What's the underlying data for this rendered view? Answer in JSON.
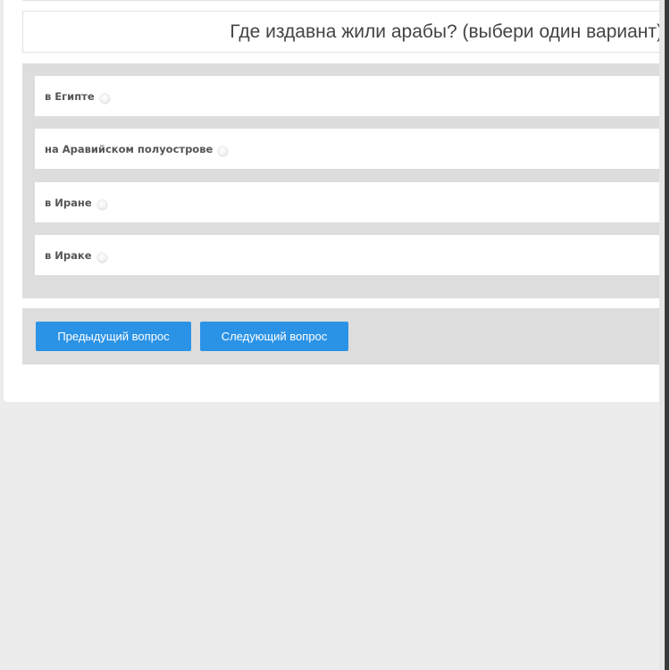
{
  "question": {
    "text": "Где издавна жили арабы? (выбери один вариант)"
  },
  "options": [
    {
      "label": "в Египте"
    },
    {
      "label": "на Аравийском полуострове"
    },
    {
      "label": "в Иране"
    },
    {
      "label": "в Ираке"
    }
  ],
  "navigation": {
    "prev_label": "Предыдущий вопрос",
    "next_label": "Следующий вопрос"
  },
  "colors": {
    "page_background": "#ececec",
    "panel_background": "#dddddd",
    "button_accent": "#2b93e6"
  }
}
